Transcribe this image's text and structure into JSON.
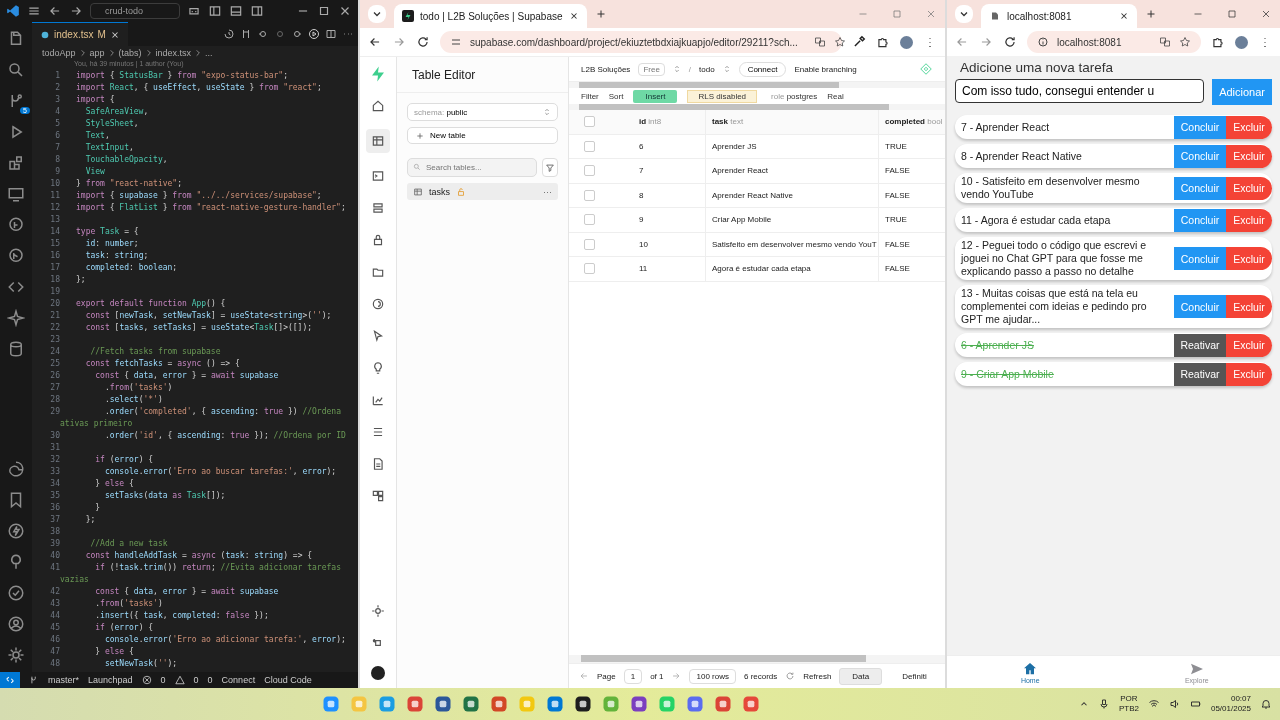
{
  "vscode": {
    "search": "crud-todo",
    "tab": {
      "label": "index.tsx",
      "status": "M"
    },
    "breadcrumb": [
      "todoApp",
      "app",
      "(tabs)",
      "index.tsx",
      "..."
    ],
    "blame": "You, há 39 minutos | 1 author (You)",
    "scm_badge": "5",
    "lines": [
      {
        "n": "1",
        "text": "import { StatusBar } from \"expo-status-bar\";"
      },
      {
        "n": "2",
        "text": "import React, { useEffect, useState } from \"react\";"
      },
      {
        "n": "3",
        "text": "import {"
      },
      {
        "n": "4",
        "text": "  SafeAreaView,"
      },
      {
        "n": "5",
        "text": "  StyleSheet,"
      },
      {
        "n": "6",
        "text": "  Text,"
      },
      {
        "n": "7",
        "text": "  TextInput,"
      },
      {
        "n": "8",
        "text": "  TouchableOpacity,"
      },
      {
        "n": "9",
        "text": "  View"
      },
      {
        "n": "10",
        "text": "} from \"react-native\";"
      },
      {
        "n": "11",
        "text": "import { supabase } from \"../../services/supabase\";"
      },
      {
        "n": "12",
        "text": "import { FlatList } from \"react-native-gesture-handler\";"
      },
      {
        "n": "13"
      },
      {
        "n": "14",
        "text": "type Task = {"
      },
      {
        "n": "15",
        "text": "  id: number;"
      },
      {
        "n": "16",
        "text": "  task: string;"
      },
      {
        "n": "17",
        "text": "  completed: boolean;"
      },
      {
        "n": "18",
        "text": "};"
      },
      {
        "n": "19"
      },
      {
        "n": "20",
        "text": "export default function App() {"
      },
      {
        "n": "21",
        "text": "  const [newTask, setNewTask] = useState<string>('');"
      },
      {
        "n": "22",
        "text": "  const [tasks, setTasks] = useState<Task[]>([]);"
      },
      {
        "n": "23"
      },
      {
        "n": "24",
        "text": "   //Fetch tasks from supabase"
      },
      {
        "n": "25",
        "text": "  const fetchTasks = async () => {"
      },
      {
        "n": "26",
        "text": "    const { data, error } = await supabase"
      },
      {
        "n": "27",
        "text": "      .from('tasks')"
      },
      {
        "n": "28",
        "text": "      .select('*')"
      },
      {
        "n": "29",
        "text": "      .order('completed', { ascending: true }) //Ordena",
        "wrap": "ativas primeiro"
      },
      {
        "n": "30",
        "text": "      .order('id', { ascending: true }); //Ordena por ID"
      },
      {
        "n": "31"
      },
      {
        "n": "32",
        "text": "    if (error) {"
      },
      {
        "n": "33",
        "text": "      console.error('Erro ao buscar tarefas:', error);"
      },
      {
        "n": "34",
        "text": "    } else {"
      },
      {
        "n": "35",
        "text": "      setTasks(data as Task[]);"
      },
      {
        "n": "36",
        "text": "    }"
      },
      {
        "n": "37",
        "text": "  };"
      },
      {
        "n": "38"
      },
      {
        "n": "39",
        "text": "   //Add a new task"
      },
      {
        "n": "40",
        "text": "  const handleAddTask = async (task: string) => {"
      },
      {
        "n": "41",
        "text": "    if (!task.trim()) return; //Evita adicionar tarefas",
        "wrap": "vazias"
      },
      {
        "n": "42",
        "text": "    const { data, error } = await supabase"
      },
      {
        "n": "43",
        "text": "    .from('tasks')"
      },
      {
        "n": "44",
        "text": "    .insert({ task, completed: false });"
      },
      {
        "n": "45",
        "text": "    if (error) {"
      },
      {
        "n": "46",
        "text": "      console.error('Erro ao adicionar tarefa:', error);"
      },
      {
        "n": "47",
        "text": "    } else {"
      },
      {
        "n": "48",
        "text": "      setNewTask('');"
      }
    ],
    "status_bar": {
      "branch": "master*",
      "launchpad": "Launchpad",
      "errors": "0",
      "warnings": "0",
      "ports": "0",
      "connect": "Connect",
      "cloud": "Cloud Code"
    }
  },
  "supabase_window": {
    "tab": "todo | L2B Soluções | Supabase",
    "url": "supabase.com/dashboard/project/ekiuztetbdxiajkuapjo/editor/29211?sch...",
    "sidebar": {
      "title": "Table Editor",
      "schema_label": "schema:",
      "schema": "public",
      "new_table": "New table",
      "search_placeholder": "Search tables...",
      "tables": [
        {
          "name": "tasks",
          "selected": true,
          "more": "···"
        }
      ]
    },
    "top_bar": {
      "org": "L2B Soluções",
      "plan": "Free",
      "separator": "/",
      "project": "todo",
      "connect": "Connect",
      "branching": "Enable branching"
    },
    "toolbar": {
      "filter": "Filter",
      "sort": "Sort",
      "insert": "Insert",
      "rls": "RLS disabled",
      "role_label": "role",
      "role": "postgres",
      "realtime": "Real"
    },
    "table": {
      "all_selected": false,
      "row_selected": [
        false,
        false,
        false,
        false,
        false,
        false
      ],
      "columns": [
        {
          "name": "id",
          "type": "int8"
        },
        {
          "name": "task",
          "type": "text"
        },
        {
          "name": "completed",
          "type": "bool"
        }
      ],
      "rows": [
        [
          "6",
          "Aprender JS",
          "TRUE"
        ],
        [
          "7",
          "Aprender React",
          "FALSE"
        ],
        [
          "8",
          "Aprender React Native",
          "FALSE"
        ],
        [
          "9",
          "Criar App Mobile",
          "TRUE"
        ],
        [
          "10",
          "Satisfeito em desenvolver mesmo vendo YouT",
          "FALSE"
        ],
        [
          "11",
          "Agora é estudar cada etapa",
          "FALSE"
        ]
      ]
    },
    "footer": {
      "page_label": "Page",
      "page": "1",
      "page_total": "of 1",
      "rows": "100 rows",
      "records": "6 records",
      "refresh": "Refresh",
      "tabs": [
        {
          "label": "Data",
          "selected": true
        },
        {
          "label": "Definiti",
          "selected": false
        }
      ]
    }
  },
  "app_window": {
    "tab": "localhost:8081",
    "url": "localhost:8081",
    "heading": "Adicione uma nova tarefa",
    "input": {
      "value": "Com isso tudo, consegui entender u"
    },
    "add_button": "Adicionar",
    "tasks": [
      {
        "text": "7 - Aprender React",
        "completed": false,
        "action": "Concluir",
        "delete": "Excluir"
      },
      {
        "text": "8 - Aprender React Native",
        "completed": false,
        "action": "Concluir",
        "delete": "Excluir"
      },
      {
        "text": "10 - Satisfeito em desenvolver mesmo vendo YouTube",
        "completed": false,
        "action": "Concluir",
        "delete": "Excluir"
      },
      {
        "text": "11 - Agora é estudar cada etapa",
        "completed": false,
        "action": "Concluir",
        "delete": "Excluir"
      },
      {
        "text": "12 - Peguei todo o código que escrevi e joguei no Chat GPT para que fosse me explicando passo a passo no detalhe",
        "completed": false,
        "action": "Concluir",
        "delete": "Excluir"
      },
      {
        "text": "13 - Muitas coisas que está na tela eu complementei com ideias e pedindo pro GPT me ajudar...",
        "completed": false,
        "action": "Concluir",
        "delete": "Excluir"
      },
      {
        "text": "6 - Aprender JS",
        "completed": true,
        "action": "Reativar",
        "delete": "Excluir"
      },
      {
        "text": "9 - Criar App Mobile",
        "completed": true,
        "action": "Reativar",
        "delete": "Excluir"
      }
    ],
    "tab_bar": [
      {
        "kind": "home",
        "label": "Home",
        "selected": true
      },
      {
        "kind": "send",
        "label": "Explore",
        "selected": false
      }
    ]
  },
  "taskbar": {
    "language": "POR",
    "layout": "PTB2",
    "time": "00:07",
    "date": "05/01/2025"
  }
}
